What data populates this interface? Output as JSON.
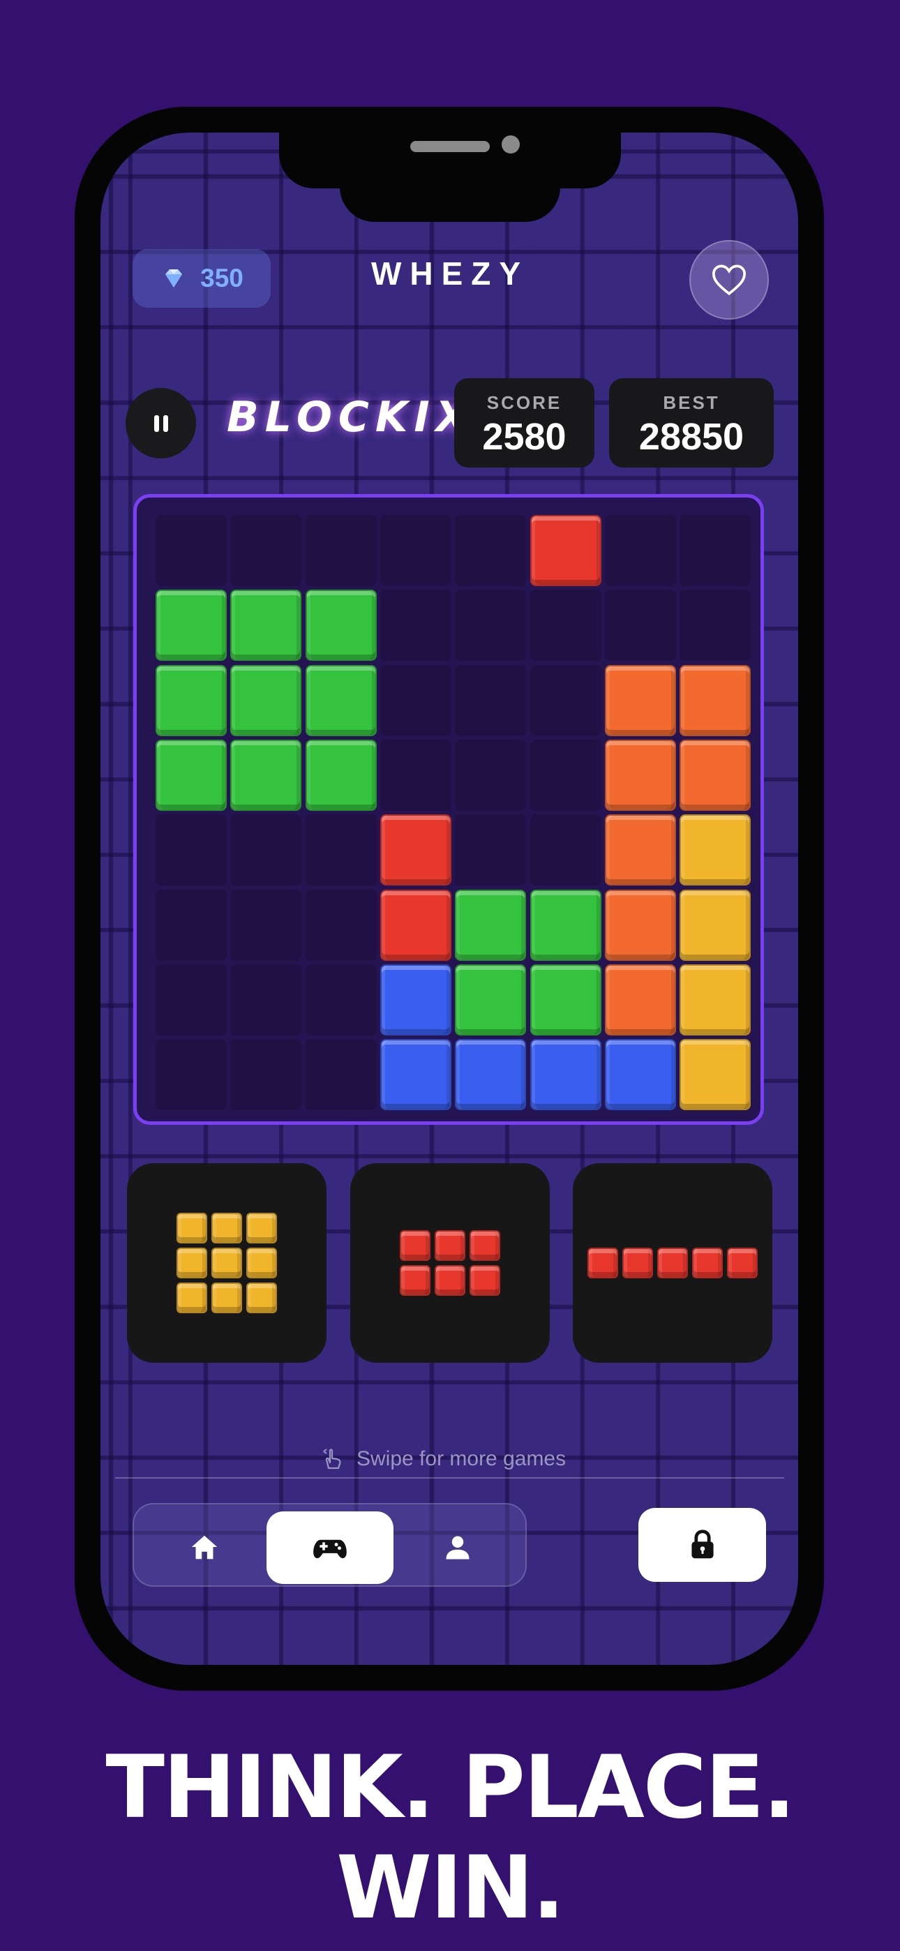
{
  "header": {
    "gems": "350",
    "brand": "WHEZY"
  },
  "game": {
    "title": "BLOCKIX",
    "score_label": "SCORE",
    "score": "2580",
    "best_label": "BEST",
    "best": "28850"
  },
  "colors": {
    "green": "#35c33f",
    "red": "#e8382e",
    "orange": "#f26a30",
    "yellow": "#f1b52c",
    "blue": "#3a5ff0",
    "board_border": "#7b3ff2",
    "background": "#34106f"
  },
  "board": {
    "rows": [
      [
        "",
        "",
        "",
        "",
        "",
        "R",
        "",
        ""
      ],
      [
        "G",
        "G",
        "G",
        "",
        "",
        "",
        "",
        ""
      ],
      [
        "G",
        "G",
        "G",
        "",
        "",
        "",
        "O",
        "O"
      ],
      [
        "G",
        "G",
        "G",
        "",
        "",
        "",
        "O",
        "O"
      ],
      [
        "",
        "",
        "",
        "R",
        "",
        "",
        "O",
        "Y"
      ],
      [
        "",
        "",
        "",
        "R",
        "G",
        "G",
        "O",
        "Y"
      ],
      [
        "",
        "",
        "",
        "B",
        "G",
        "G",
        "O",
        "Y"
      ],
      [
        "",
        "",
        "",
        "B",
        "B",
        "B",
        "B",
        "Y"
      ]
    ]
  },
  "pieces": [
    {
      "color": "yellow",
      "rows": 3,
      "cols": 3
    },
    {
      "color": "red",
      "rows": 2,
      "cols": 3
    },
    {
      "color": "red",
      "rows": 1,
      "cols": 5
    }
  ],
  "footer": {
    "swipe_text": "Swipe for more games",
    "nav_items": [
      "home-icon",
      "gamepad-icon",
      "user-icon"
    ],
    "active_nav": "gamepad-icon",
    "lock_icon": "lock-icon"
  },
  "tagline": "THINK. PLACE. WIN."
}
